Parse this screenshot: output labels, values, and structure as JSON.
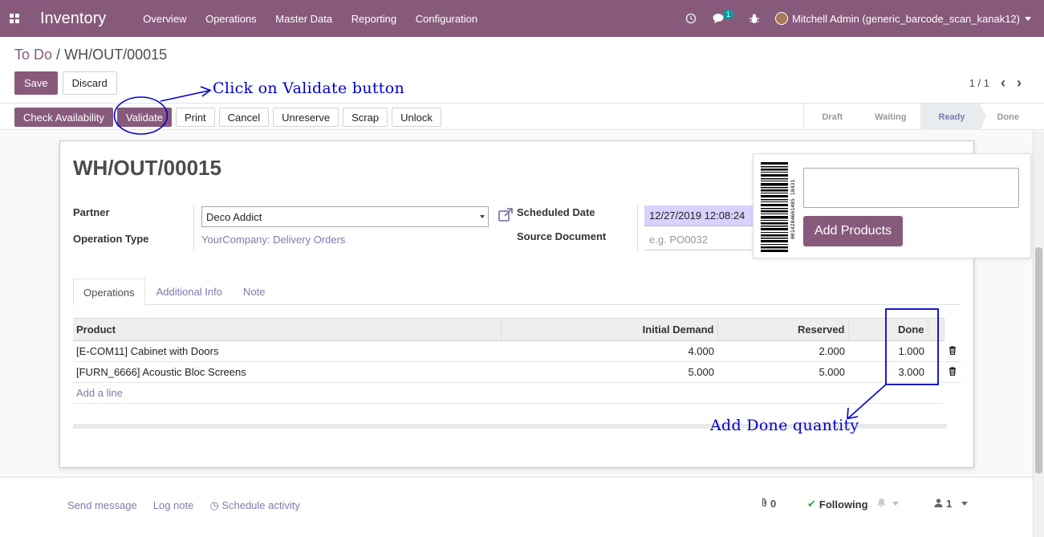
{
  "navbar": {
    "app_name": "Inventory",
    "menus": [
      "Overview",
      "Operations",
      "Master Data",
      "Reporting",
      "Configuration"
    ],
    "message_count": "1",
    "user": "Mitchell Admin (generic_barcode_scan_kanak12)",
    "bg_color": "#875a7b"
  },
  "breadcrumb": {
    "parent": "To Do",
    "separator": "/",
    "current": "WH/OUT/00015"
  },
  "form_buttons": {
    "save": "Save",
    "discard": "Discard"
  },
  "pager": {
    "value": "1 / 1"
  },
  "header_buttons": {
    "check_availability": "Check Availability",
    "validate": "Validate",
    "print": "Print",
    "cancel": "Cancel",
    "unreserve": "Unreserve",
    "scrap": "Scrap",
    "unlock": "Unlock"
  },
  "statusbar": {
    "steps": [
      "Draft",
      "Waiting",
      "Ready",
      "Done"
    ],
    "active": "Ready"
  },
  "record": {
    "title": "WH/OUT/00015",
    "partner_label": "Partner",
    "partner_value": "Deco Addict",
    "operation_type_label": "Operation Type",
    "operation_type_value": "YourCompany: Delivery Orders",
    "scheduled_date_label": "Scheduled Date",
    "scheduled_date_value": "12/27/2019 12:08:24",
    "source_document_label": "Source Document",
    "source_document_placeholder": "e.g. PO0032"
  },
  "barcode_panel": {
    "barcode_text": "0014284601485 18431",
    "button": "Add Products"
  },
  "tabs": [
    "Operations",
    "Additional Info",
    "Note"
  ],
  "operations_table": {
    "columns": [
      "Product",
      "Initial Demand",
      "Reserved",
      "Done"
    ],
    "rows": [
      {
        "product": "[E-COM11] Cabinet with Doors",
        "initial_demand": "4.000",
        "reserved": "2.000",
        "done": "1.000"
      },
      {
        "product": "[FURN_6666] Acoustic Bloc Screens",
        "initial_demand": "5.000",
        "reserved": "5.000",
        "done": "3.000"
      }
    ],
    "add_line": "Add a line"
  },
  "chatter": {
    "send_message": "Send message",
    "log_note": "Log note",
    "schedule_activity": "Schedule activity",
    "attachments": "0",
    "following": "Following",
    "followers": "1"
  },
  "annotations": {
    "validate_hint": "Click on Validate button",
    "done_hint": "Add Done quantity",
    "color": "#0000cc"
  }
}
